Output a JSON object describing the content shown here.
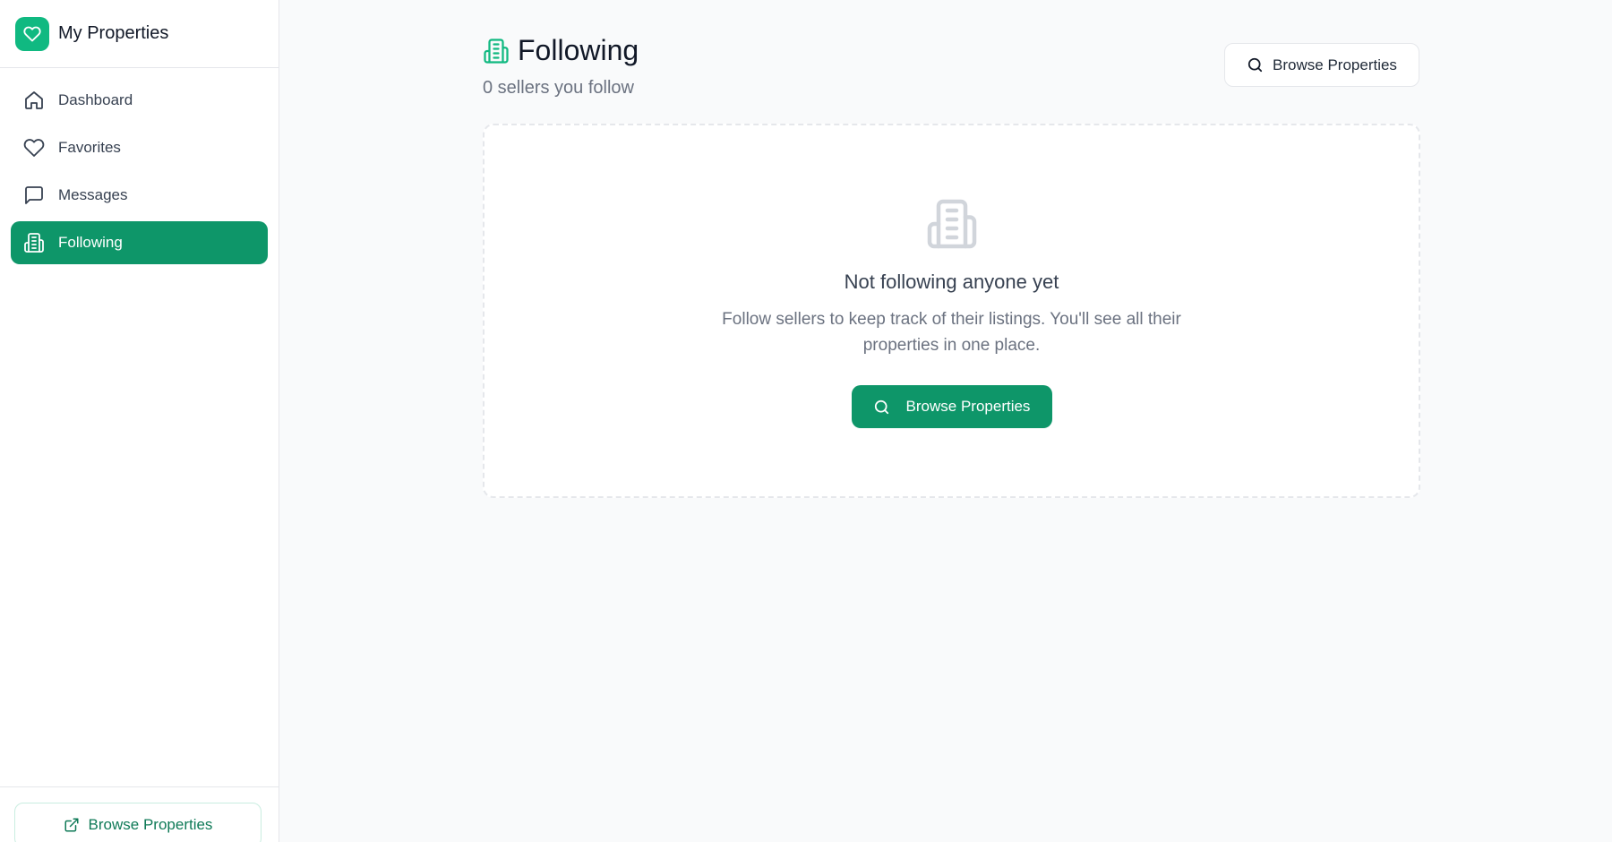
{
  "app": {
    "title": "My Properties",
    "logo_icon": "heart-icon",
    "accent": "#0e9669",
    "accent_light": "#10b981"
  },
  "sidebar": {
    "items": [
      {
        "label": "Dashboard",
        "icon": "home-icon",
        "active": false
      },
      {
        "label": "Favorites",
        "icon": "heart-icon",
        "active": false
      },
      {
        "label": "Messages",
        "icon": "message-icon",
        "active": false
      },
      {
        "label": "Following",
        "icon": "building-icon",
        "active": true
      }
    ],
    "footer_button": {
      "label": "Browse Properties",
      "icon": "external-link-icon"
    }
  },
  "header": {
    "title": "Following",
    "title_icon": "building-icon",
    "subtitle": "0 sellers you follow",
    "browse_button": {
      "label": "Browse Properties",
      "icon": "search-icon"
    }
  },
  "empty_state": {
    "icon": "building-icon",
    "title": "Not following anyone yet",
    "description": "Follow sellers to keep track of their listings. You'll see all their properties in one place.",
    "button": {
      "label": "Browse Properties",
      "icon": "search-icon"
    }
  }
}
